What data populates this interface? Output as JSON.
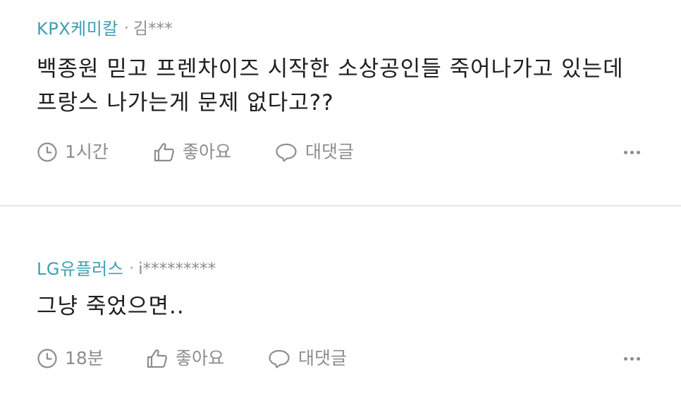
{
  "comments": [
    {
      "author": "KPX케미칼",
      "separator": "·",
      "user": "김***",
      "body": "백종원 믿고 프렌차이즈 시작한 소상공인들 죽어나가고 있는데 프랑스 나가는게 문제 없다고??",
      "time": "1시간",
      "like_label": "좋아요",
      "reply_label": "대댓글",
      "more_icon": "more-dots-icon"
    },
    {
      "author": "LG유플러스",
      "separator": "·",
      "user": "i*********",
      "body": "그냥 죽었으면..",
      "time": "18분",
      "like_label": "좋아요",
      "reply_label": "대댓글",
      "more_icon": "more-dots-icon"
    }
  ],
  "colors": {
    "author": "#3e9fb3",
    "meta_gray": "#8d8d8d",
    "body_text": "#1e1e1e",
    "divider": "#e6e6e6"
  }
}
